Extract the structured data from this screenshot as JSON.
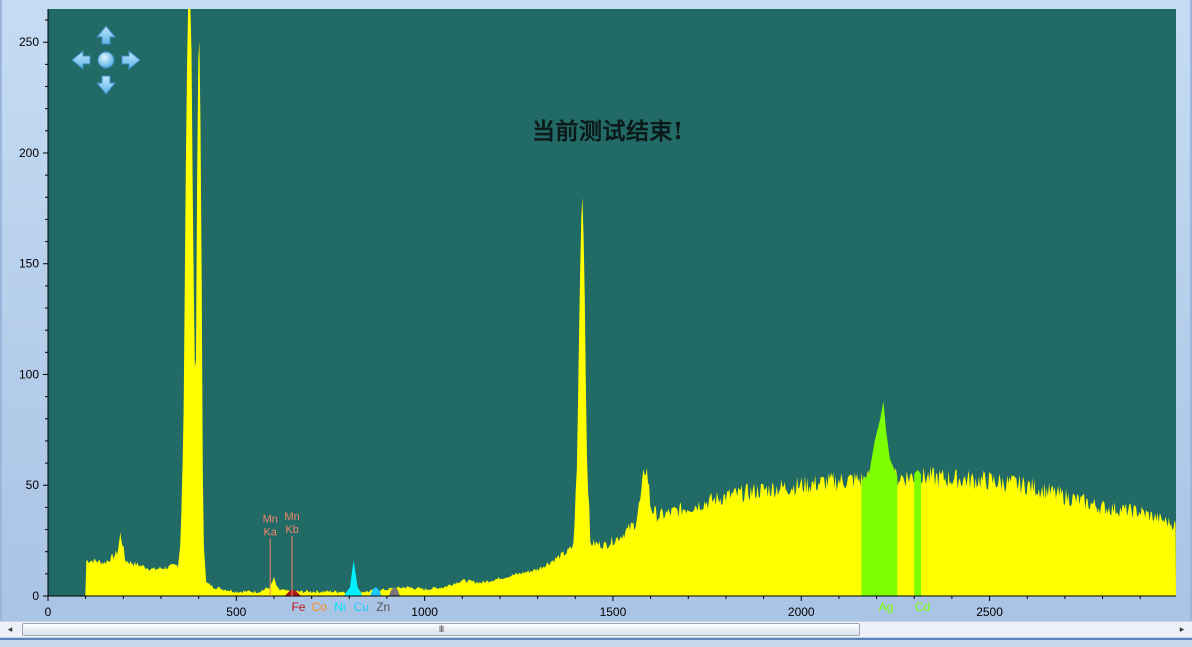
{
  "chart_data": {
    "type": "area",
    "title": "",
    "xlabel": "",
    "ylabel": "",
    "xlim": [
      0,
      2995
    ],
    "ylim": [
      0,
      265
    ],
    "x_ticks": [
      0,
      500,
      1000,
      1500,
      2000,
      2500
    ],
    "y_ticks": [
      0,
      50,
      100,
      150,
      200,
      250
    ],
    "grid": false,
    "spectrum_anchors": [
      [
        0,
        0
      ],
      [
        100,
        0
      ],
      [
        102,
        16
      ],
      [
        120,
        16
      ],
      [
        150,
        15
      ],
      [
        175,
        18
      ],
      [
        185,
        20
      ],
      [
        192,
        28
      ],
      [
        198,
        24
      ],
      [
        205,
        16
      ],
      [
        240,
        14
      ],
      [
        280,
        12
      ],
      [
        320,
        13
      ],
      [
        345,
        14
      ],
      [
        352,
        25
      ],
      [
        360,
        80
      ],
      [
        368,
        230
      ],
      [
        372,
        265
      ],
      [
        380,
        265
      ],
      [
        386,
        150
      ],
      [
        392,
        80
      ],
      [
        398,
        240
      ],
      [
        403,
        253
      ],
      [
        407,
        170
      ],
      [
        412,
        30
      ],
      [
        420,
        6
      ],
      [
        440,
        4
      ],
      [
        500,
        2
      ],
      [
        560,
        2
      ],
      [
        590,
        4
      ],
      [
        600,
        8
      ],
      [
        610,
        3
      ],
      [
        640,
        2
      ],
      [
        700,
        2
      ],
      [
        750,
        2
      ],
      [
        800,
        2
      ],
      [
        850,
        2
      ],
      [
        900,
        3
      ],
      [
        950,
        4
      ],
      [
        1000,
        3
      ],
      [
        1050,
        4
      ],
      [
        1100,
        7
      ],
      [
        1150,
        6
      ],
      [
        1200,
        8
      ],
      [
        1250,
        10
      ],
      [
        1300,
        12
      ],
      [
        1350,
        17
      ],
      [
        1380,
        20
      ],
      [
        1395,
        23
      ],
      [
        1405,
        60
      ],
      [
        1412,
        140
      ],
      [
        1418,
        186
      ],
      [
        1424,
        150
      ],
      [
        1430,
        70
      ],
      [
        1440,
        24
      ],
      [
        1480,
        23
      ],
      [
        1520,
        27
      ],
      [
        1560,
        33
      ],
      [
        1575,
        45
      ],
      [
        1585,
        59
      ],
      [
        1592,
        55
      ],
      [
        1600,
        40
      ],
      [
        1620,
        36
      ],
      [
        1700,
        40
      ],
      [
        1800,
        45
      ],
      [
        1900,
        48
      ],
      [
        2000,
        50
      ],
      [
        2100,
        52
      ],
      [
        2200,
        53
      ],
      [
        2300,
        54
      ],
      [
        2400,
        53
      ],
      [
        2500,
        52
      ],
      [
        2600,
        50
      ],
      [
        2700,
        45
      ],
      [
        2800,
        40
      ],
      [
        2900,
        38
      ],
      [
        2995,
        32
      ]
    ],
    "highlight_regions": [
      {
        "element": "Ni",
        "color": "#00f0ff",
        "peak": [
          [
            785,
            0
          ],
          [
            802,
            4
          ],
          [
            808,
            12
          ],
          [
            812,
            16
          ],
          [
            816,
            11
          ],
          [
            822,
            4
          ],
          [
            835,
            0
          ]
        ]
      },
      {
        "element": "Cu",
        "color": "#1ec8ff",
        "peak": [
          [
            855,
            0
          ],
          [
            862,
            3
          ],
          [
            870,
            4
          ],
          [
            878,
            3
          ],
          [
            886,
            0
          ]
        ]
      },
      {
        "element": "Fe",
        "color": "#b01818",
        "peak": [
          [
            628,
            0
          ],
          [
            640,
            2
          ],
          [
            650,
            3
          ],
          [
            660,
            2
          ],
          [
            672,
            0
          ]
        ]
      },
      {
        "element": "Zn",
        "color": "#777777",
        "peak": [
          [
            905,
            0
          ],
          [
            912,
            3
          ],
          [
            920,
            4
          ],
          [
            928,
            3
          ],
          [
            935,
            0
          ]
        ]
      },
      {
        "element": "Ag",
        "color": "#7cff00",
        "range": [
          2160,
          2255
        ],
        "peak": [
          [
            2160,
            52
          ],
          [
            2180,
            55
          ],
          [
            2195,
            70
          ],
          [
            2210,
            80
          ],
          [
            2218,
            88
          ],
          [
            2225,
            75
          ],
          [
            2235,
            62
          ],
          [
            2255,
            54
          ]
        ]
      },
      {
        "element": "Cd",
        "color": "#7cff00",
        "range": [
          2300,
          2318
        ],
        "peak": [
          [
            2300,
            55
          ],
          [
            2309,
            57
          ],
          [
            2318,
            55
          ]
        ]
      }
    ],
    "element_labels": [
      {
        "text": "Fe",
        "x": 665,
        "color": "#c01818"
      },
      {
        "text": "Co",
        "x": 720,
        "color": "#ff8c1a"
      },
      {
        "text": "Ni",
        "x": 775,
        "color": "#00e5ff"
      },
      {
        "text": "Cu",
        "x": 832,
        "color": "#1ec8ff"
      },
      {
        "text": "Zn",
        "x": 890,
        "color": "#555555"
      },
      {
        "text": "Ag",
        "x": 2225,
        "color": "#7cff00"
      },
      {
        "text": "Cd",
        "x": 2322,
        "color": "#7cff00"
      }
    ],
    "annotations": [
      {
        "lines": [
          "Mn",
          "Ka"
        ],
        "x": 590,
        "y": 26,
        "color": "#f0856a"
      },
      {
        "lines": [
          "Mn",
          "Kb"
        ],
        "x": 648,
        "y": 27,
        "color": "#f0856a"
      }
    ],
    "colors": {
      "plot_background": "#226a66",
      "spectrum_fill": "#ffff00"
    }
  },
  "status": {
    "message": "当前测试结束!"
  },
  "pan_control": {
    "up_icon": "arrow-up-icon",
    "down_icon": "arrow-down-icon",
    "left_icon": "arrow-left-icon",
    "right_icon": "arrow-right-icon",
    "center_icon": "center-dot-icon"
  },
  "scrollbar": {
    "left_arrow": "◂",
    "right_arrow": "▸",
    "grip": "III"
  }
}
